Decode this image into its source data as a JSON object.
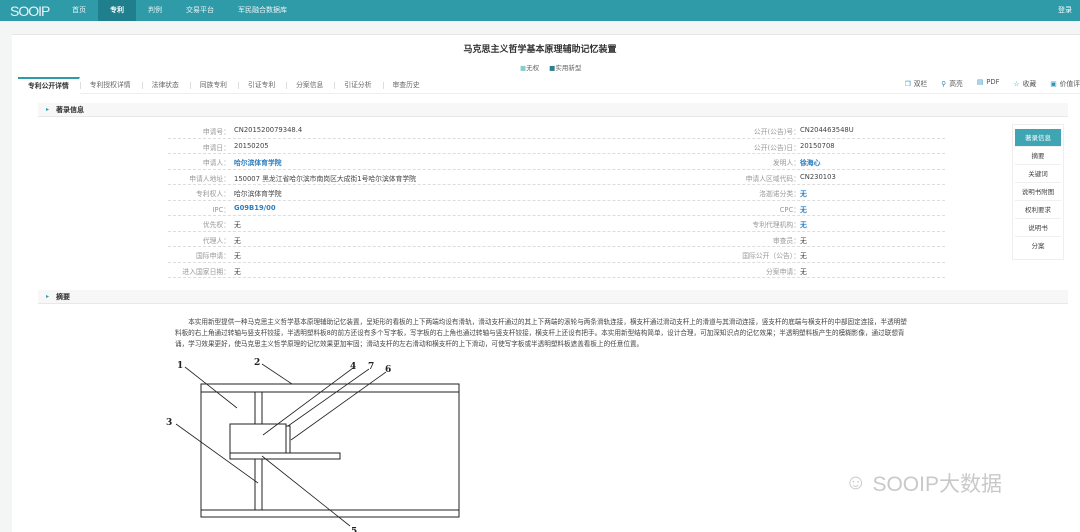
{
  "nav": {
    "logo": "SOOIP",
    "items": [
      "首页",
      "专利",
      "判例",
      "交易平台",
      "军民融合数据库"
    ],
    "active": 1,
    "login": "登录"
  },
  "title": "马克思主义哲学基本原理辅助记忆装置",
  "badges": [
    "无权",
    "实用新型"
  ],
  "tabs": [
    "专利公开详情",
    "专利授权详情",
    "法律状态",
    "同族专利",
    "引证专利",
    "分案信息",
    "引证分析",
    "审查历史"
  ],
  "tools": [
    {
      "icon": "columns-icon",
      "label": "双栏"
    },
    {
      "icon": "pin-icon",
      "label": "高亮"
    },
    {
      "icon": "pdf-icon",
      "label": "PDF"
    },
    {
      "icon": "star-icon",
      "label": "收藏"
    },
    {
      "icon": "value-icon",
      "label": "价值评"
    }
  ],
  "sections": {
    "biblio": "著录信息",
    "abstract": "摘要"
  },
  "left_fields": [
    {
      "label": "申请号：",
      "value": "CN201520079348.4"
    },
    {
      "label": "申请日：",
      "value": "20150205"
    },
    {
      "label": "申请人：",
      "value": "哈尔滨体育学院",
      "link": true
    },
    {
      "label": "申请人地址：",
      "value": "150007 黑龙江省哈尔滨市南岗区大成街1号哈尔滨体育学院"
    },
    {
      "label": "专利权人：",
      "value": "哈尔滨体育学院"
    },
    {
      "label": "IPC：",
      "value": "G09B19/00",
      "link": true
    },
    {
      "label": "优先权：",
      "value": "无"
    },
    {
      "label": "代理人：",
      "value": "无"
    },
    {
      "label": "国际申请：",
      "value": "无"
    },
    {
      "label": "进入国家日期：",
      "value": "无"
    }
  ],
  "right_fields": [
    {
      "label": "公开(公告)号：",
      "value": "CN204463548U"
    },
    {
      "label": "公开(公告)日：",
      "value": "20150708"
    },
    {
      "label": "发明人：",
      "value": "徐海心",
      "link": true
    },
    {
      "label": "申请人区域代码：",
      "value": "CN230103"
    },
    {
      "label": "洛迦诺分类：",
      "value": "无",
      "link": true
    },
    {
      "label": "CPC：",
      "value": "无",
      "link": true
    },
    {
      "label": "专利代理机构：",
      "value": "无",
      "link": true
    },
    {
      "label": "审查员：",
      "value": "无"
    },
    {
      "label": "国际公开（公告）：",
      "value": "无"
    },
    {
      "label": "分案申请：",
      "value": "无"
    }
  ],
  "side_nav": [
    "著录信息",
    "摘要",
    "关键词",
    "说明书附图",
    "权利要求",
    "说明书",
    "分案"
  ],
  "abstract": "本实用新型提供一种马克思主义哲学基本原理辅助记忆装置，呈矩形的看板的上下两端均设有滑轨，滑动支杆通过的其上下两端的滚轮与两条滑轨连接，横支杆通过滑动支杆上的滑道与其滑动连接，竖支杆的底端与横支杆的中部固定连接，半透明塑料板的右上角通过转轴与竖支杆铰接，半透明塑料板8的前方还设有多个写字板，写字板的右上角也通过转轴与竖支杆铰接，横支杆上还设有把手。本实用新型结构简单，设计合理，可加深知识点的记忆效果；半透明塑料板产生的模糊影像，通过联想背诵，学习效果更好，使马克思主义哲学原理的记忆效果更加牢固；滑动支杆的左右滑动和横支杆的上下滑动，可使写字板或半透明塑料板遮盖看板上的任意位置。",
  "figure_labels": [
    "1",
    "2",
    "3",
    "4",
    "5",
    "6",
    "7"
  ],
  "watermark": "SOOIP大数据"
}
